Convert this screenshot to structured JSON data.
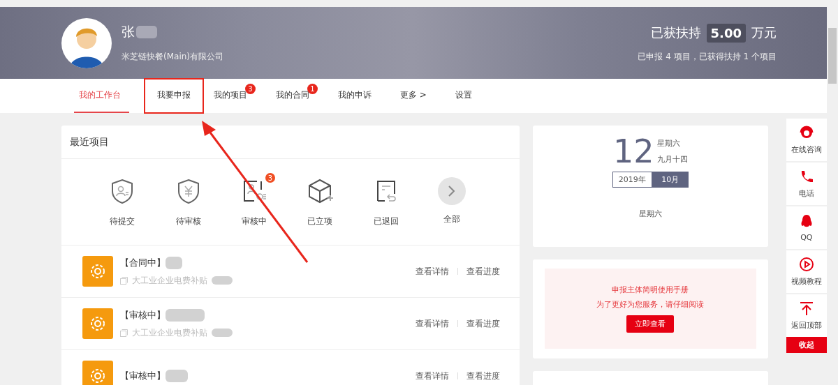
{
  "header": {
    "user_name": "张",
    "company": "米芝链快餐(Main)有限公司",
    "support_label": "已获扶持",
    "support_amount": "5.00",
    "support_unit": "万元",
    "summary": "已申报 4 项目，已获得扶持 1 个项目"
  },
  "tabs": [
    {
      "label": "我的工作台",
      "selected": true,
      "annotated": false
    },
    {
      "label": "我要申报",
      "selected": false,
      "annotated": true
    },
    {
      "label": "我的项目",
      "selected": false,
      "annotated": false,
      "badge": "3"
    },
    {
      "label": "我的合同",
      "selected": false,
      "annotated": false,
      "badge": "1"
    },
    {
      "label": "我的申诉",
      "selected": false,
      "annotated": false
    },
    {
      "label": "更多 >",
      "selected": false,
      "annotated": false
    },
    {
      "label": "设置",
      "selected": false,
      "annotated": false
    }
  ],
  "recent_projects": {
    "title": "最近项目",
    "statuses": [
      {
        "label": "待提交",
        "kind": "shield-user"
      },
      {
        "label": "待审核",
        "kind": "shield-yen"
      },
      {
        "label": "审核中",
        "kind": "review",
        "badge": "3"
      },
      {
        "label": "已立项",
        "kind": "cube"
      },
      {
        "label": "已退回",
        "kind": "returned"
      },
      {
        "label": "全部",
        "kind": "more"
      }
    ],
    "items": [
      {
        "status": "【合同中】",
        "subsidy": "大工业企业电费补贴",
        "actions": [
          "查看详情",
          "查看进度"
        ]
      },
      {
        "status": "【审核中】",
        "subsidy": "大工业企业电费补贴",
        "actions": [
          "查看详情",
          "查看进度"
        ]
      },
      {
        "status": "【审核中】",
        "actions": [
          "查看详情",
          "查看进度"
        ]
      }
    ]
  },
  "calendar": {
    "day": "12",
    "weekday": "星期六",
    "lunar": "九月十四",
    "year": "2019年",
    "month": "10月",
    "footer": "星期六"
  },
  "guide": {
    "title": "申报主体简明使用手册",
    "subtitle": "为了更好为您服务，请仔细阅读",
    "button": "立即查看"
  },
  "side_bar": {
    "items": [
      {
        "label": "在线咨询",
        "kind": "headset"
      },
      {
        "label": "电话",
        "kind": "phone"
      },
      {
        "label": "QQ",
        "kind": "penguin"
      },
      {
        "label": "视频教程",
        "kind": "play"
      },
      {
        "label": "返回顶部",
        "kind": "top"
      }
    ],
    "collapse": "收起"
  }
}
